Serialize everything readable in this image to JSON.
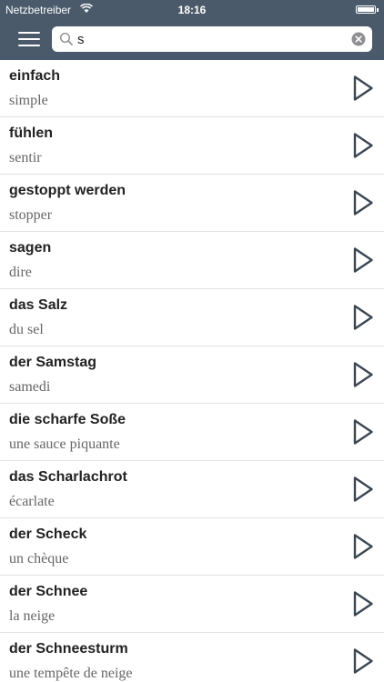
{
  "status_bar": {
    "carrier": "Netzbetreiber",
    "time": "18:16",
    "wifi_icon": "wifi-icon",
    "battery_icon": "battery-icon"
  },
  "nav": {
    "menu_icon": "hamburger-menu-icon",
    "search": {
      "value": "s",
      "icon": "search-icon",
      "clear_icon": "clear-icon"
    }
  },
  "colors": {
    "navbar": "#4a5a6a",
    "play_icon": "#3b4652",
    "divider": "#e2e2e2"
  },
  "entries": [
    {
      "de": "einfach",
      "fr": "simple"
    },
    {
      "de": "fühlen",
      "fr": "sentir"
    },
    {
      "de": "gestoppt werden",
      "fr": "stopper"
    },
    {
      "de": "sagen",
      "fr": "dire"
    },
    {
      "de": "das Salz",
      "fr": "du sel"
    },
    {
      "de": "der Samstag",
      "fr": "samedi"
    },
    {
      "de": "die scharfe Soße",
      "fr": "une sauce piquante"
    },
    {
      "de": "das Scharlachrot",
      "fr": "écarlate"
    },
    {
      "de": "der Scheck",
      "fr": "un chèque"
    },
    {
      "de": "der Schnee",
      "fr": "la neige"
    },
    {
      "de": "der Schneesturm",
      "fr": "une tempête de neige"
    }
  ]
}
